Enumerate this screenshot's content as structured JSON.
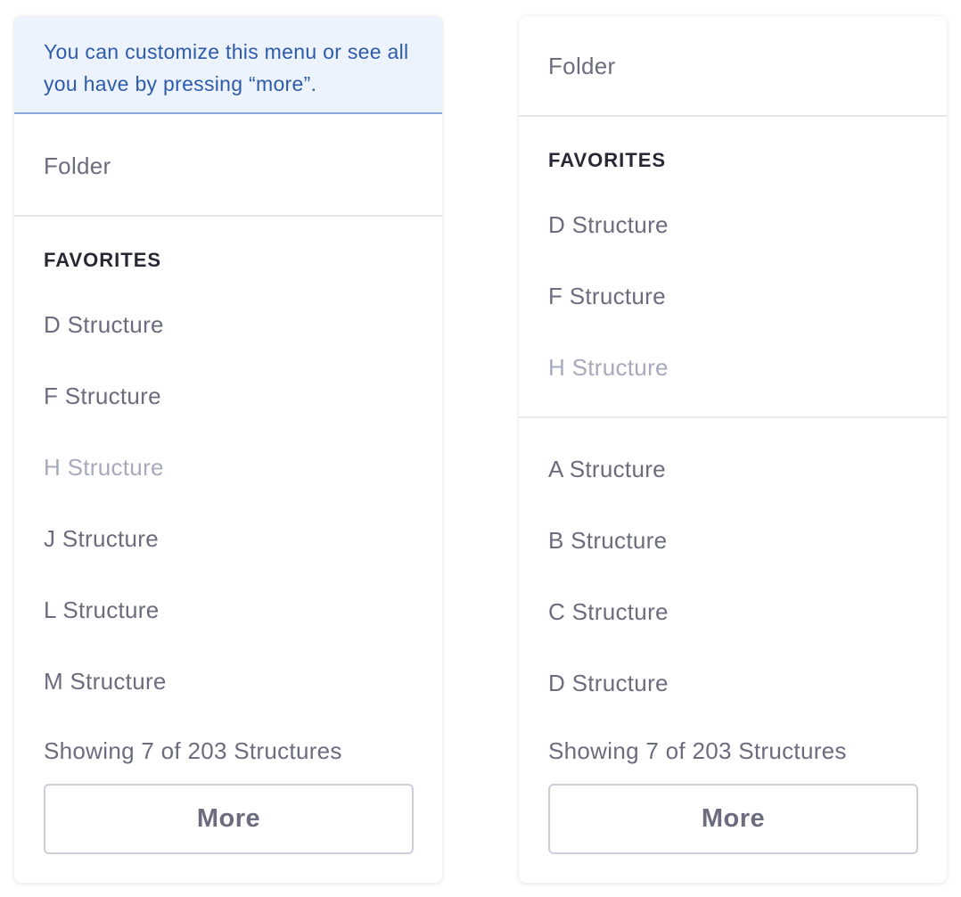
{
  "left_menu": {
    "info_text": "You can customize this menu or see all you have by pressing “more”.",
    "folder_label": "Folder",
    "favorites_header": "FAVORITES",
    "items": [
      {
        "label": "D Structure",
        "disabled": false
      },
      {
        "label": "F Structure",
        "disabled": false
      },
      {
        "label": "H Structure",
        "disabled": true
      },
      {
        "label": "J Structure",
        "disabled": false
      },
      {
        "label": "L Structure",
        "disabled": false
      },
      {
        "label": "M Structure",
        "disabled": false
      }
    ],
    "status_text": "Showing 7 of 203 Structures",
    "more_label": "More"
  },
  "right_menu": {
    "folder_label": "Folder",
    "favorites_header": "FAVORITES",
    "favorite_items": [
      {
        "label": "D Structure",
        "disabled": false
      },
      {
        "label": "F Structure",
        "disabled": false
      },
      {
        "label": "H Structure",
        "disabled": true
      }
    ],
    "items": [
      {
        "label": "A Structure",
        "disabled": false
      },
      {
        "label": "B Structure",
        "disabled": false
      },
      {
        "label": "C Structure",
        "disabled": false
      },
      {
        "label": "D Structure",
        "disabled": false
      }
    ],
    "status_text": "Showing 7 of 203 Structures",
    "more_label": "More"
  },
  "colors": {
    "info_background": "#edf3fd",
    "info_text": "#2e5aac",
    "item_text": "#6b6c7e",
    "disabled_text": "#a7a9bc",
    "header_text": "#272833",
    "divider": "#e7e7ed",
    "button_border": "#cdced9"
  }
}
